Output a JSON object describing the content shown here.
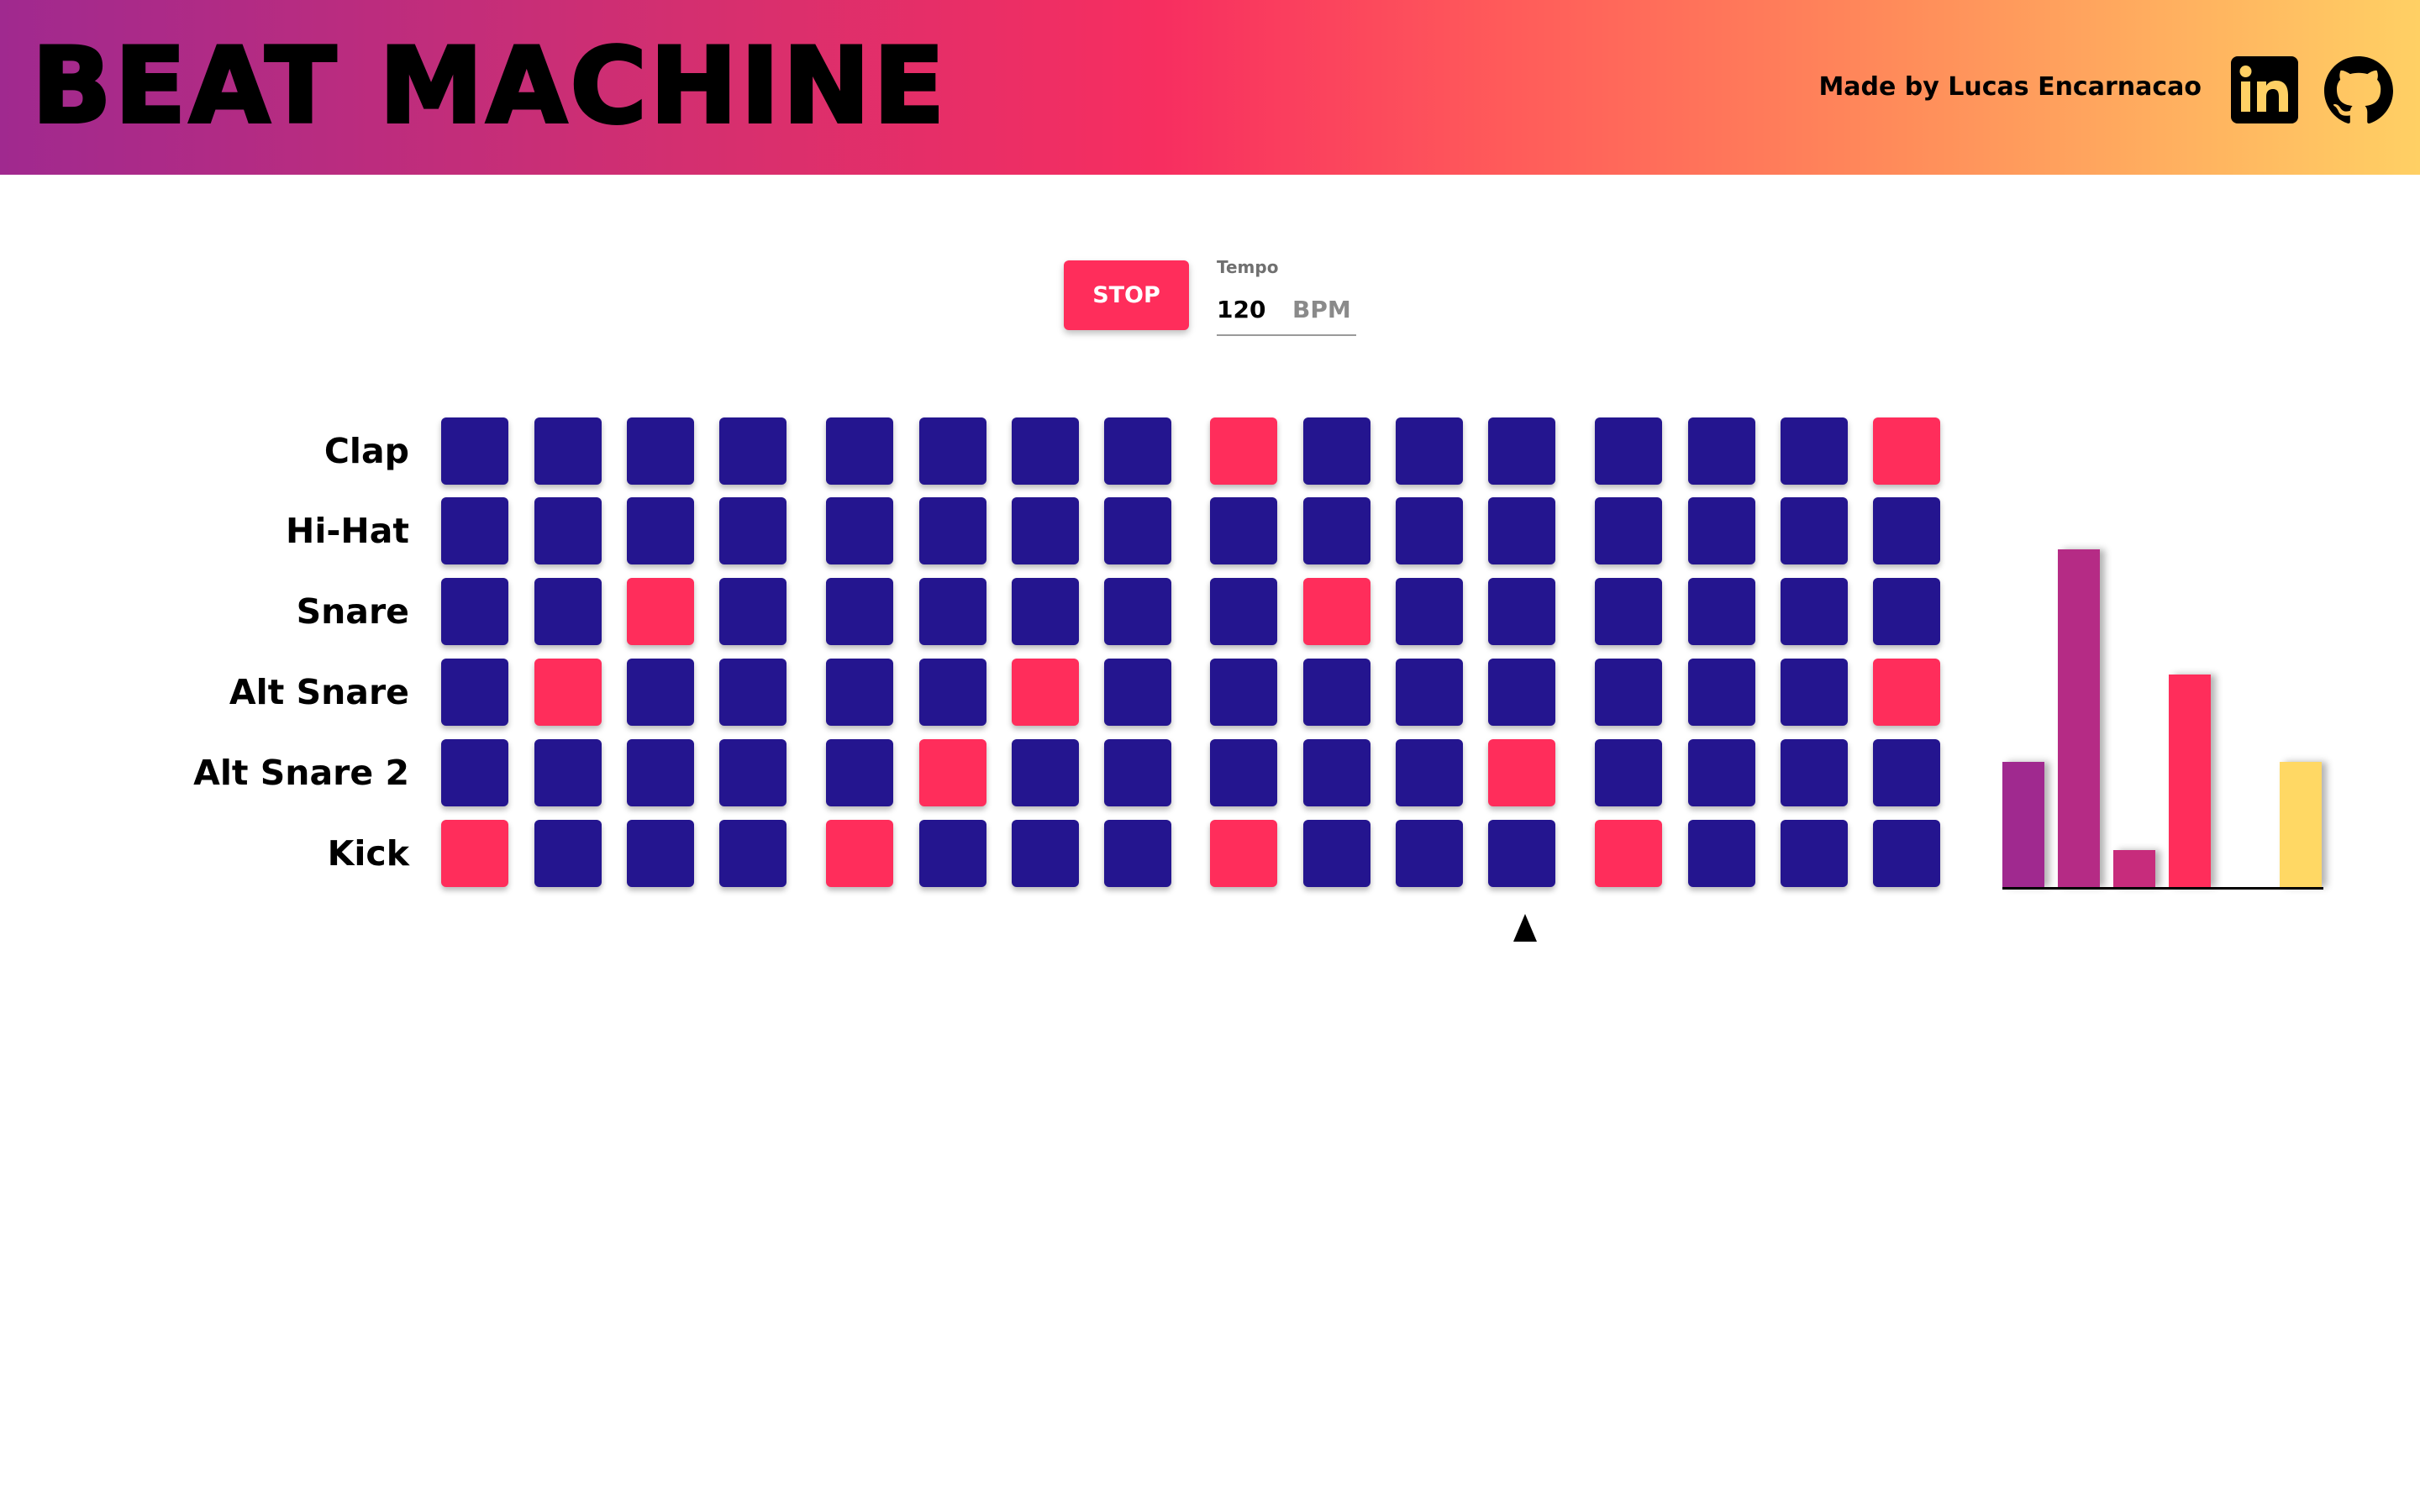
{
  "header": {
    "title": "BEAT MACHINE",
    "credit": "Made by Lucas Encarnacao"
  },
  "icons": {
    "linkedin": "linkedin-icon",
    "github": "github-icon"
  },
  "controls": {
    "stop_label": "STOP",
    "tempo_label": "Tempo",
    "tempo_value": "120",
    "tempo_unit": "BPM"
  },
  "colors": {
    "pad_off": "#24158f",
    "pad_on": "#ff2d5b",
    "header_gradient": [
      "#a0298f",
      "#f72e60",
      "#ffd064"
    ]
  },
  "sequencer": {
    "current_step": 12,
    "rows": [
      {
        "label": "Clap",
        "steps": [
          0,
          0,
          0,
          0,
          0,
          0,
          0,
          0,
          1,
          0,
          0,
          0,
          0,
          0,
          0,
          1
        ]
      },
      {
        "label": "Hi-Hat",
        "steps": [
          0,
          0,
          0,
          0,
          0,
          0,
          0,
          0,
          0,
          0,
          0,
          0,
          0,
          0,
          0,
          0
        ]
      },
      {
        "label": "Snare",
        "steps": [
          0,
          0,
          1,
          0,
          0,
          0,
          0,
          0,
          0,
          1,
          0,
          0,
          0,
          0,
          0,
          0
        ]
      },
      {
        "label": "Alt Snare",
        "steps": [
          0,
          1,
          0,
          0,
          0,
          0,
          1,
          0,
          0,
          0,
          0,
          0,
          0,
          0,
          0,
          1
        ]
      },
      {
        "label": "Alt Snare 2",
        "steps": [
          0,
          0,
          0,
          0,
          0,
          1,
          0,
          0,
          0,
          0,
          0,
          1,
          0,
          0,
          0,
          0
        ]
      },
      {
        "label": "Kick",
        "steps": [
          1,
          0,
          0,
          0,
          1,
          0,
          0,
          0,
          1,
          0,
          0,
          0,
          1,
          0,
          0,
          0
        ]
      }
    ]
  },
  "visualizer": {
    "levels": [
      0.37,
      1.0,
      0.11,
      0.63,
      0.0,
      0.37
    ],
    "colors": [
      "#a0298f",
      "#b52b85",
      "#c72c7c",
      "#ff2d5b",
      "#ff7a55",
      "#ffd864"
    ]
  }
}
